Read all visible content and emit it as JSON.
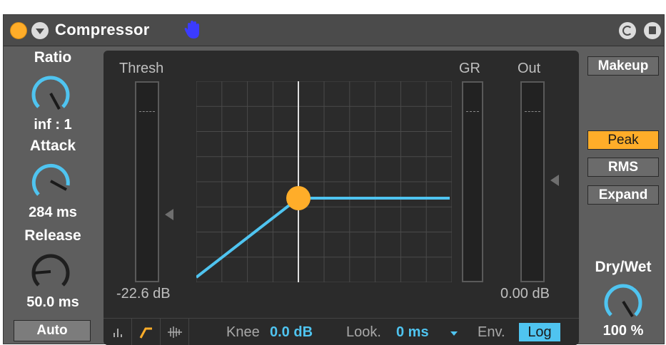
{
  "device": {
    "title": "Compressor",
    "icons": {
      "power": "power-icon",
      "fold": "fold-chevron-icon",
      "hand": "hand-icon",
      "hot_swap": "hot-swap-icon",
      "save": "save-preset-icon"
    }
  },
  "left": {
    "ratio_label": "Ratio",
    "ratio_value": "inf : 1",
    "attack_label": "Attack",
    "attack_value": "284 ms",
    "release_label": "Release",
    "release_value": "50.0 ms",
    "auto_label": "Auto"
  },
  "display": {
    "thresh_label": "Thresh",
    "thresh_value": "-22.6 dB",
    "gr_label": "GR",
    "out_label": "Out",
    "out_value": "0.00 dB"
  },
  "toolbar": {
    "knee_label": "Knee",
    "knee_value": "0.0 dB",
    "look_label": "Look.",
    "look_value": "0 ms",
    "env_label": "Env.",
    "env_value": "Log",
    "view_icons": [
      "collapsed-view-icon",
      "transfer-curve-icon",
      "activity-view-icon"
    ]
  },
  "right": {
    "makeup_label": "Makeup",
    "modes": [
      "Peak",
      "RMS",
      "Expand"
    ],
    "active_mode": "Peak",
    "drywet_label": "Dry/Wet",
    "drywet_value": "100 %"
  },
  "colors": {
    "accent": "#ffad29",
    "blue": "#4fc4f0",
    "hand": "#3b3bff"
  }
}
